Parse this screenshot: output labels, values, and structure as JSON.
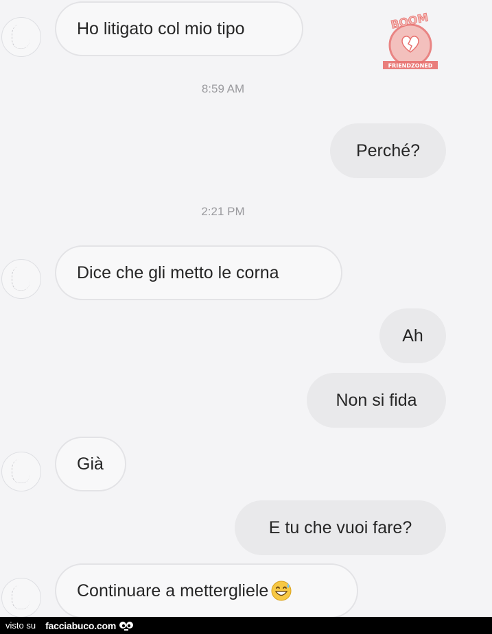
{
  "messages": [
    {
      "text": "Ho litigato col mio tipo",
      "side": "incoming"
    },
    {
      "text": "Perché?",
      "side": "outgoing"
    },
    {
      "text": "Dice che gli metto le corna",
      "side": "incoming"
    },
    {
      "text": "Ah",
      "side": "outgoing"
    },
    {
      "text": "Non si fida",
      "side": "outgoing"
    },
    {
      "text": "Già",
      "side": "incoming"
    },
    {
      "text": "E tu che vuoi fare?",
      "side": "outgoing"
    },
    {
      "text": "Continuare a mettergliele",
      "side": "incoming",
      "emoji": "grinning-sweat-emoji"
    }
  ],
  "timestamps": [
    "8:59 AM",
    "2:21 PM"
  ],
  "watermark": {
    "top_text": "BOOM",
    "ribbon_text": "FRIENDZONED",
    "color": "#e8716f"
  },
  "footer": {
    "prefix": "visto su",
    "site": "facciabuco.com"
  },
  "colors": {
    "background": "#f4f4f6",
    "incoming_bubble": "#f8f8f9",
    "outgoing_bubble": "#e9e9eb",
    "timestamp": "#9a9a9e",
    "footer_bar": "#000000"
  }
}
